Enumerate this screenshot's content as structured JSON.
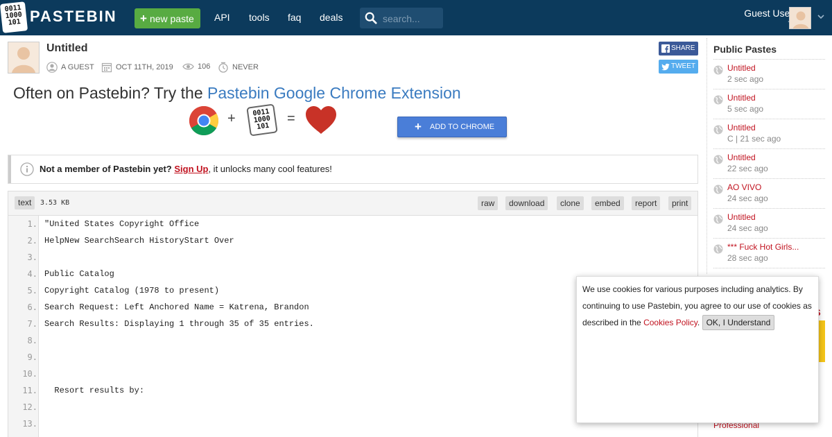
{
  "header": {
    "logo_digits": [
      "0011",
      "1000",
      "101"
    ],
    "brand": "PASTEBIN",
    "new_paste_label": "new paste",
    "nav": [
      "API",
      "tools",
      "faq",
      "deals"
    ],
    "search_placeholder": "search...",
    "user_name": "Guest User",
    "user_sub": "-"
  },
  "paste": {
    "title": "Untitled",
    "author": "A GUEST",
    "date": "OCT 11TH, 2019",
    "views": "106",
    "expiry": "NEVER",
    "share_label": "SHARE",
    "tweet_label": "TWEET"
  },
  "promo": {
    "text": "Often on Pastebin? Try the ",
    "link": "Pastebin Google Chrome Extension",
    "plus": "+",
    "equals": "=",
    "button": "ADD TO CHROME"
  },
  "notice": {
    "bold": "Not a member of Pastebin yet?",
    "link": "Sign Up",
    "rest": ", it unlocks many cool features!"
  },
  "code": {
    "syntax": "text",
    "size": "3.53 KB",
    "actions": [
      "raw",
      "download",
      "clone",
      "embed",
      "report",
      "print"
    ],
    "lines": [
      "\"United States Copyright Office",
      "HelpNew SearchSearch HistoryStart Over",
      "",
      "Public Catalog",
      "Copyright Catalog (1978 to present)",
      "Search Request: Left Anchored Name = Katrena, Brandon",
      "Search Results: Displaying 1 through 35 of 35 entries.",
      "",
      "",
      "",
      "  Resort results by:",
      "",
      ""
    ],
    "line_numbers": [
      "1.",
      "2.",
      "3.",
      "4.",
      "5.",
      "6.",
      "7.",
      "8.",
      "9.",
      "10.",
      "11.",
      "12.",
      "13."
    ]
  },
  "sidebar": {
    "title": "Public Pastes",
    "items": [
      {
        "title": "Untitled",
        "meta": "2 sec ago"
      },
      {
        "title": "Untitled",
        "meta": "5 sec ago"
      },
      {
        "title": "Untitled",
        "meta": "C | 21 sec ago"
      },
      {
        "title": "Untitled",
        "meta": "22 sec ago"
      },
      {
        "title": "AO VIVO",
        "meta": "24 sec ago"
      },
      {
        "title": "Untitled",
        "meta": "24 sec ago"
      },
      {
        "title": "*** Fuck Hot Girls...",
        "meta": "28 sec ago"
      }
    ],
    "partial_heading": "S",
    "partial_link": "Professional"
  },
  "cookie": {
    "text": "We use cookies for various purposes including analytics. By continuing to use Pastebin, you agree to our use of cookies as described in the ",
    "policy_link": "Cookies Policy",
    "period": ".",
    "ok": "OK, I Understand"
  },
  "colors": {
    "header_bg": "#0c3a5c",
    "new_paste_green": "#58ab42",
    "link_red": "#c1121f",
    "promo_blue": "#3a7bc0",
    "facebook": "#3b5998",
    "twitter": "#55acee"
  },
  "icons": [
    "logo-icon",
    "plus-icon",
    "search-icon",
    "user-avatar",
    "chevron-down-icon",
    "calendar-icon",
    "eye-icon",
    "clock-icon",
    "facebook-icon",
    "twitter-icon",
    "chrome-icon",
    "heart-icon",
    "info-icon",
    "globe-icon",
    "close-icon"
  ]
}
